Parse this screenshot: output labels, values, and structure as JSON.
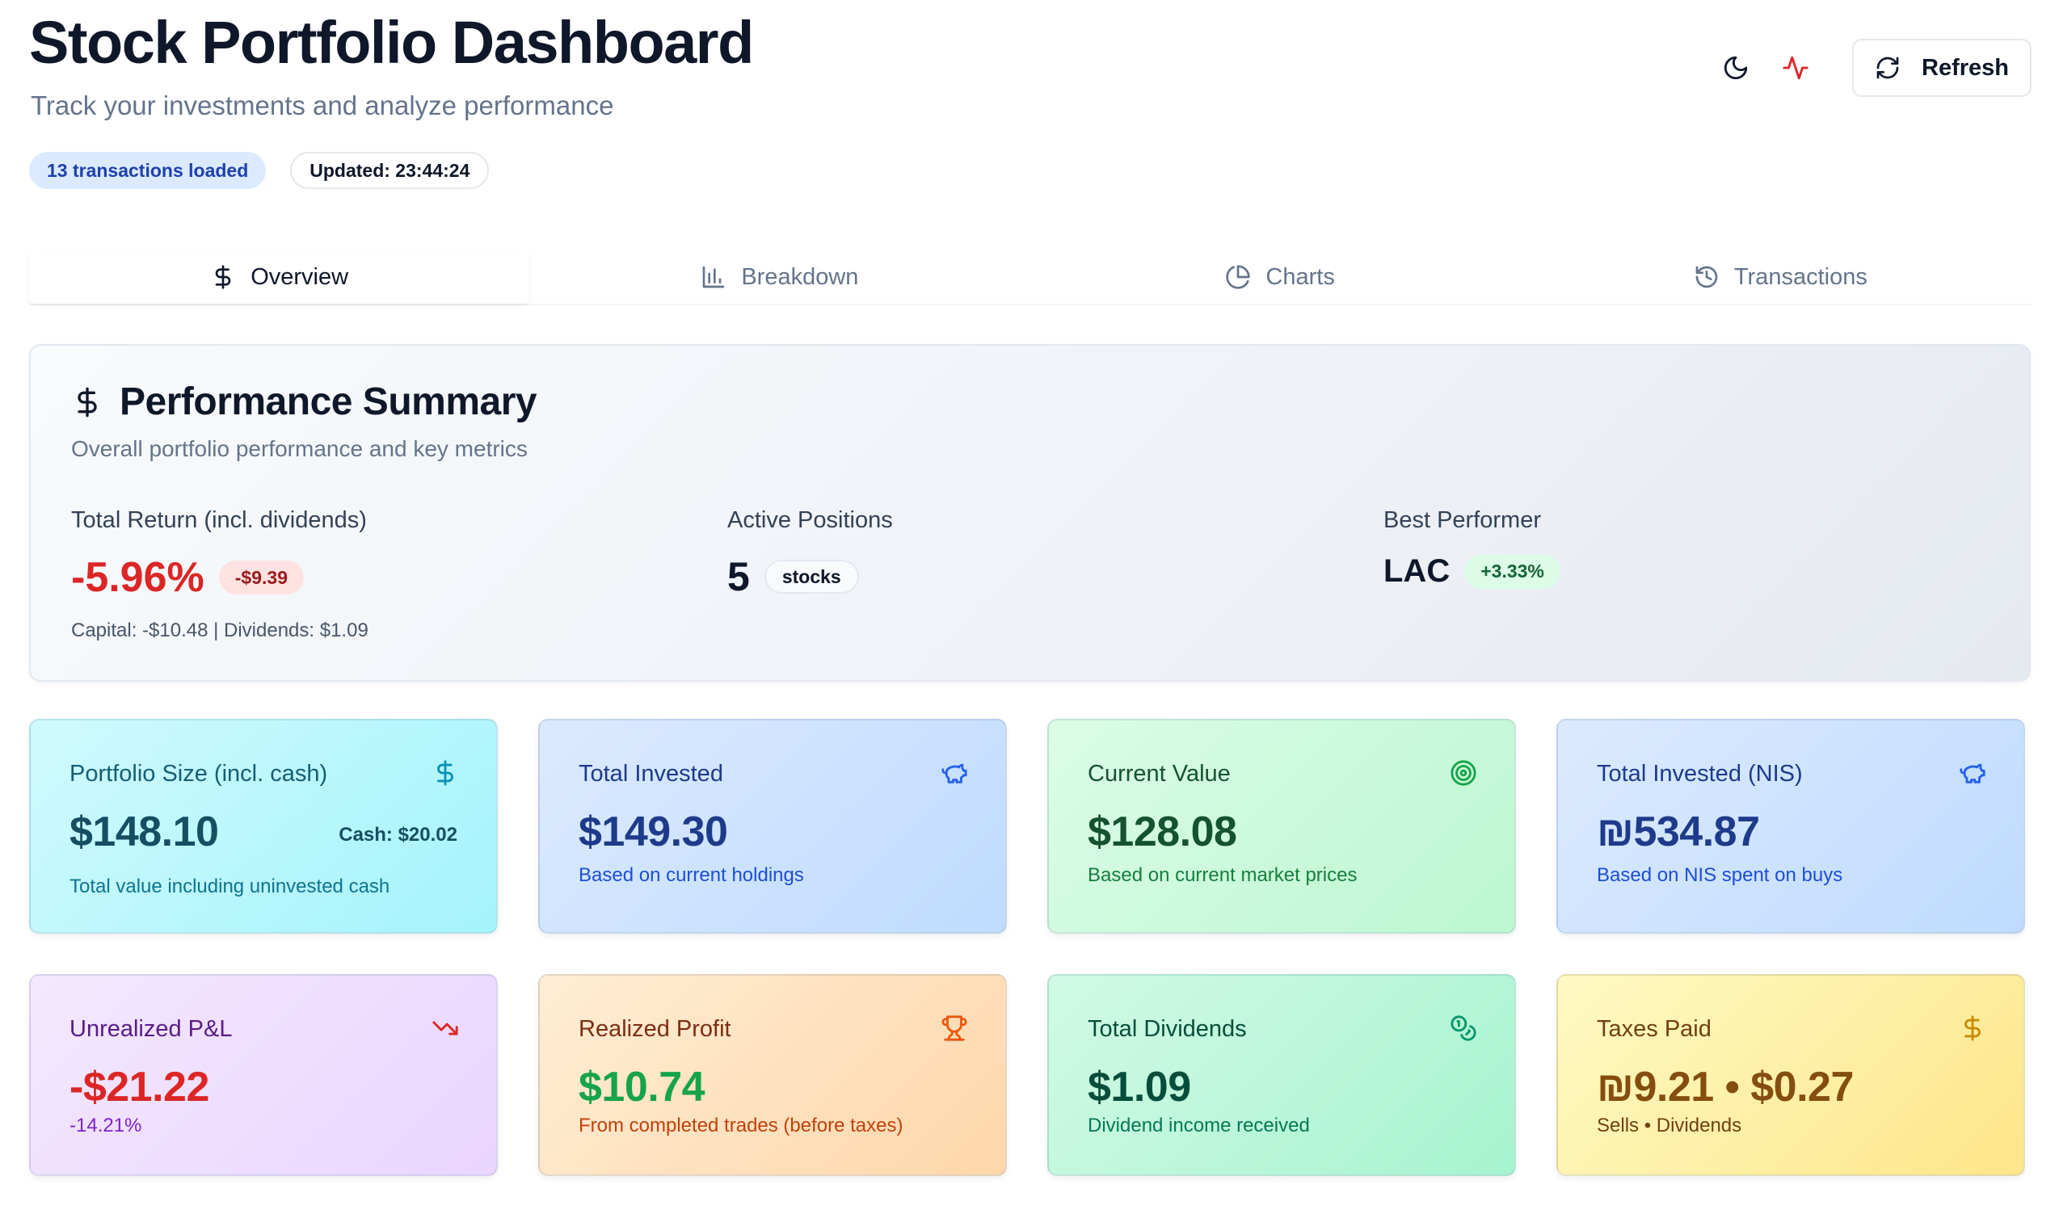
{
  "header": {
    "title": "Stock Portfolio Dashboard",
    "subtitle": "Track your investments and analyze performance",
    "badge_transactions": "13 transactions loaded",
    "badge_updated": "Updated: 23:44:24",
    "refresh_label": "Refresh",
    "icons": [
      "moon-icon",
      "activity-icon",
      "refresh-icon"
    ]
  },
  "tabs": [
    {
      "label": "Overview",
      "icon": "dollar-icon",
      "active": true
    },
    {
      "label": "Breakdown",
      "icon": "bar-chart-icon",
      "active": false
    },
    {
      "label": "Charts",
      "icon": "pie-chart-icon",
      "active": false
    },
    {
      "label": "Transactions",
      "icon": "history-icon",
      "active": false
    }
  ],
  "performance": {
    "title": "Performance Summary",
    "subtitle": "Overall portfolio performance and key metrics",
    "total_return": {
      "label": "Total Return (incl. dividends)",
      "value": "-5.96%",
      "pill": "-$9.39",
      "note": "Capital: -$10.48 | Dividends: $1.09"
    },
    "active_positions": {
      "label": "Active Positions",
      "value": "5",
      "pill": "stocks"
    },
    "best_performer": {
      "label": "Best Performer",
      "value": "LAC",
      "pill": "+3.33%"
    }
  },
  "cards": {
    "portfolio_size": {
      "label": "Portfolio Size (incl. cash)",
      "value": "$148.10",
      "side": "Cash: $20.02",
      "foot": "Total value including uninvested cash",
      "icon": "dollar-icon"
    },
    "total_invested": {
      "label": "Total Invested",
      "value": "$149.30",
      "foot": "Based on current holdings",
      "icon": "piggy-bank-icon"
    },
    "current_value": {
      "label": "Current Value",
      "value": "$128.08",
      "foot": "Based on current market prices",
      "icon": "target-icon"
    },
    "total_invested_nis": {
      "label": "Total Invested (NIS)",
      "value": "₪534.87",
      "foot": "Based on NIS spent on buys",
      "icon": "piggy-bank-icon"
    },
    "unrealized_pnl": {
      "label": "Unrealized P&L",
      "value": "-$21.22",
      "foot": "-14.21%",
      "icon": "trending-down-icon"
    },
    "realized_profit": {
      "label": "Realized Profit",
      "value": "$10.74",
      "foot": "From completed trades (before taxes)",
      "icon": "trophy-icon"
    },
    "total_dividends": {
      "label": "Total Dividends",
      "value": "$1.09",
      "foot": "Dividend income received",
      "icon": "coins-icon"
    },
    "taxes_paid": {
      "label": "Taxes Paid",
      "value": "₪9.21 • $0.27",
      "foot": "Sells • Dividends",
      "icon": "dollar-icon"
    }
  },
  "colors": {
    "negative": "#dc2626",
    "positive": "#15803d",
    "accent_cyan": "#a5f3fc",
    "accent_blue": "#bfdbfe",
    "accent_green": "#bbf7d0",
    "accent_purple": "#e9d5ff",
    "accent_orange": "#fed7aa",
    "accent_mint": "#a7f3d0",
    "accent_yellow": "#fde68a"
  }
}
